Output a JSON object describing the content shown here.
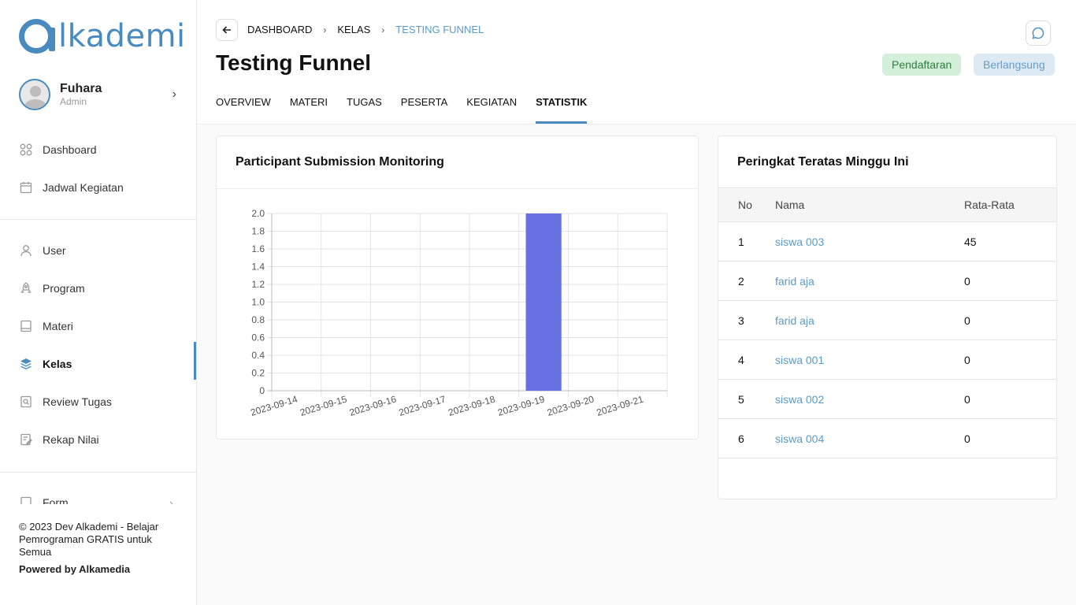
{
  "brand": {
    "logo_text": "lkademi",
    "accent": "#4a8bbf"
  },
  "profile": {
    "name": "Fuhara",
    "role": "Admin"
  },
  "nav": {
    "group1": [
      {
        "label": "Dashboard",
        "icon": "grid-icon"
      },
      {
        "label": "Jadwal Kegiatan",
        "icon": "calendar-icon"
      }
    ],
    "group2": [
      {
        "label": "User",
        "icon": "user-icon"
      },
      {
        "label": "Program",
        "icon": "rocket-icon"
      },
      {
        "label": "Materi",
        "icon": "book-icon"
      },
      {
        "label": "Kelas",
        "icon": "layers-icon",
        "active": true
      },
      {
        "label": "Review Tugas",
        "icon": "review-icon"
      },
      {
        "label": "Rekap Nilai",
        "icon": "edit-icon"
      }
    ],
    "partial_item": "Form"
  },
  "footer": {
    "copyright": "© 2023 Dev Alkademi - Belajar Pemrograman GRATIS untuk Semua",
    "powered": "Powered by Alkamedia"
  },
  "breadcrumb": {
    "item1": "DASHBOARD",
    "item2": "KELAS",
    "current": "TESTING FUNNEL"
  },
  "page": {
    "title": "Testing Funnel"
  },
  "badges": {
    "registration": "Pendaftaran",
    "ongoing": "Berlangsung"
  },
  "tabs": [
    "OVERVIEW",
    "MATERI",
    "TUGAS",
    "PESERTA",
    "KEGIATAN",
    "STATISTIK"
  ],
  "active_tab": "STATISTIK",
  "chart_card": {
    "title": "Participant Submission Monitoring"
  },
  "chart_data": {
    "type": "bar",
    "categories": [
      "2023-09-14",
      "2023-09-15",
      "2023-09-16",
      "2023-09-17",
      "2023-09-18",
      "2023-09-19",
      "2023-09-20",
      "2023-09-21"
    ],
    "values": [
      0,
      0,
      0,
      0,
      0,
      2,
      0,
      0
    ],
    "yticks": [
      "0",
      "0.2",
      "0.4",
      "0.6",
      "0.8",
      "1.0",
      "1.2",
      "1.4",
      "1.6",
      "1.8",
      "2.0"
    ],
    "ylim": [
      0,
      2
    ],
    "bar_color": "#6670e0",
    "grid": true,
    "title": "",
    "xlabel": "",
    "ylabel": ""
  },
  "ranking": {
    "title": "Peringkat Teratas Minggu Ini",
    "headers": {
      "no": "No",
      "name": "Nama",
      "avg": "Rata-Rata"
    },
    "rows": [
      {
        "no": "1",
        "name": "siswa 003",
        "avg": "45"
      },
      {
        "no": "2",
        "name": "farid aja",
        "avg": "0"
      },
      {
        "no": "3",
        "name": "farid aja",
        "avg": "0"
      },
      {
        "no": "4",
        "name": "siswa 001",
        "avg": "0"
      },
      {
        "no": "5",
        "name": "siswa 002",
        "avg": "0"
      },
      {
        "no": "6",
        "name": "siswa 004",
        "avg": "0"
      }
    ]
  }
}
